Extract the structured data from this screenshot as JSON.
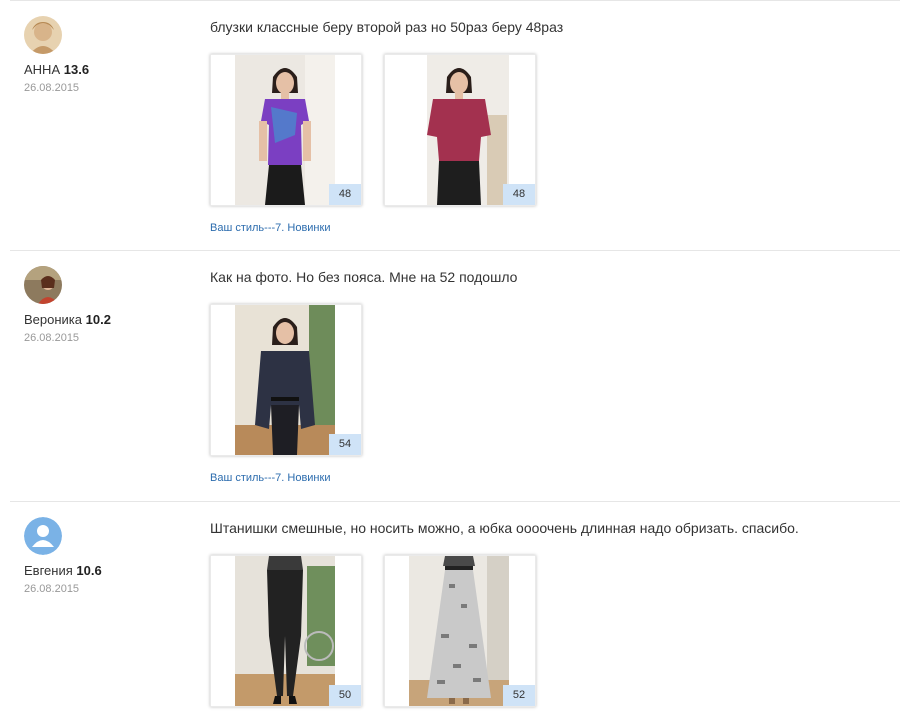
{
  "reviews": [
    {
      "name": "АННА",
      "rating": "13.6",
      "date": "26.08.2015",
      "avatar": "photo-avatar-icon",
      "text": "блузки классные беру второй раз но 50раз беру 48раз",
      "photos": [
        {
          "size": "48",
          "top_color": "#7b3fc2",
          "bottom_color": "#1b1b1b"
        },
        {
          "size": "48",
          "top_color": "#a3314f",
          "bottom_color": "#1e1e1e"
        }
      ],
      "link": "Ваш стиль---7. Новинки"
    },
    {
      "name": "Вероника",
      "rating": "10.2",
      "date": "26.08.2015",
      "avatar": "photo-avatar-icon",
      "text": "Как на фото. Но без пояса. Мне на 52 подошло",
      "photos": [
        {
          "size": "54",
          "top_color": "#2d3244",
          "bottom_color": "#1e1e24"
        }
      ],
      "link": "Ваш стиль---7. Новинки"
    },
    {
      "name": "Евгения",
      "rating": "10.6",
      "date": "26.08.2015",
      "avatar": "default-user-icon",
      "text": "Штанишки смешные, но носить можно, а юбка оооочень длинная надо обризать. спасибо.",
      "photos": [
        {
          "size": "50",
          "top_color": "#222222",
          "bottom_color": "#111111"
        },
        {
          "size": "52",
          "top_color": "#c9c9c9",
          "bottom_color": "#9a9a9a"
        }
      ],
      "link": ""
    }
  ],
  "colors": {
    "link": "#2c6cae",
    "size_badge": "#cfe3f7",
    "default_avatar": "#7ab2e6"
  }
}
